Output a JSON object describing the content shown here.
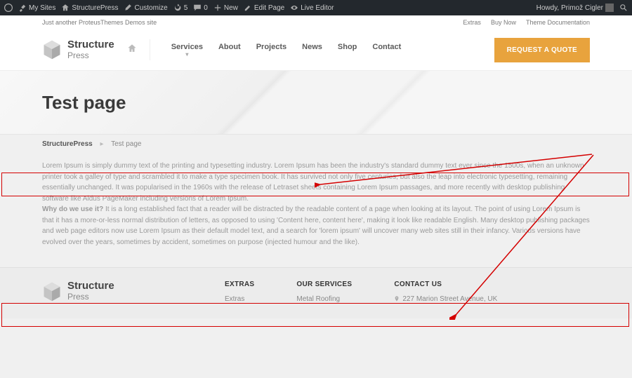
{
  "adminbar": {
    "left": [
      {
        "icon": "wp",
        "label": ""
      },
      {
        "icon": "tool",
        "label": "My Sites"
      },
      {
        "icon": "home",
        "label": "StructurePress"
      },
      {
        "icon": "brush",
        "label": "Customize"
      },
      {
        "icon": "refresh",
        "label": "5"
      },
      {
        "icon": "comment",
        "label": "0"
      },
      {
        "icon": "plus",
        "label": "New"
      },
      {
        "icon": "edit",
        "label": "Edit Page"
      },
      {
        "icon": "eye",
        "label": "Live Editor"
      }
    ],
    "right": {
      "howdy": "Howdy, Primož Cigler",
      "search": "search"
    }
  },
  "topstrip": {
    "tagline": "Just another ProteusThemes Demos site",
    "links": [
      "Extras",
      "Buy Now",
      "Theme Documentation"
    ]
  },
  "brand": {
    "line1": "Structure",
    "line2": "Press"
  },
  "nav": {
    "home_icon": "home-icon",
    "items": [
      {
        "label": "Services",
        "caret": true
      },
      {
        "label": "About",
        "caret": false
      },
      {
        "label": "Projects",
        "caret": false
      },
      {
        "label": "News",
        "caret": false
      },
      {
        "label": "Shop",
        "caret": false
      },
      {
        "label": "Contact",
        "caret": false
      }
    ],
    "cta": "REQUEST A QUOTE"
  },
  "hero": {
    "title": "Test page"
  },
  "breadcrumb": {
    "root": "StructurePress",
    "current": "Test page"
  },
  "body": {
    "p1": "Lorem Ipsum is simply dummy text of the printing and typesetting industry. Lorem Ipsum has been the industry's standard dummy text ever since the 1500s, when an unknown printer took a galley of type and scrambled it to make a type specimen book. It has survived not only five centuries, but also the leap into electronic typesetting, remaining essentially unchanged. It was popularised in the 1960s with the release of Letraset sheets containing Lorem Ipsum passages, and more recently with desktop publishing software like Aldus PageMaker including versions of Lorem Ipsum.",
    "p2_bold": "Why do we use it?",
    "p2": " It is a long established fact that a reader will be distracted by the readable content of a page when looking at its layout. The point of using Lorem Ipsum is that it has a more-or-less normal distribution of letters, as opposed to using 'Content here, content here', making it look like readable English. Many desktop publishing packages and web page editors now use Lorem Ipsum as their default model text, and a search for 'lorem ipsum' will uncover many web sites still in their infancy. Various versions have evolved over the years, sometimes by accident, sometimes on purpose (injected humour and the like)."
  },
  "footer": {
    "cols": [
      {
        "title": "EXTRAS",
        "lines": [
          "Extras"
        ]
      },
      {
        "title": "OUR SERVICES",
        "lines": [
          "Metal Roofing"
        ]
      },
      {
        "title": "CONTACT US",
        "lines": [
          "227 Marion Street Avenue, UK"
        ]
      }
    ]
  }
}
